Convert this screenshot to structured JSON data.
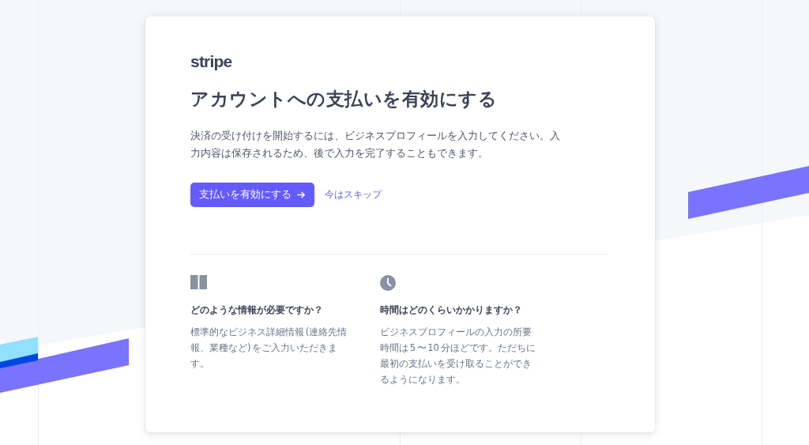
{
  "logo": "stripe",
  "title": "アカウントへの支払いを有効にする",
  "description": "決済の受け付けを開始するには、ビジネスプロフィールを入力してください。入力内容は保存されるため、後で入力を完了することもできます。",
  "primary_button": {
    "label": "支払いを有効にする"
  },
  "skip_link": "今はスキップ",
  "features": [
    {
      "kind": "book",
      "heading": "どのような情報が必要ですか？",
      "body": "標準的なビジネス詳細情報 (連絡先情報、業種など) をご入力いただきます。"
    },
    {
      "kind": "clock",
      "heading": "時間はどのくらいかかりますか？",
      "body": "ビジネスプロフィールの入力の所要時間は 5 〜 10 分ほどです。ただちに最初の支払いを受け取ることができるようになります。"
    }
  ]
}
